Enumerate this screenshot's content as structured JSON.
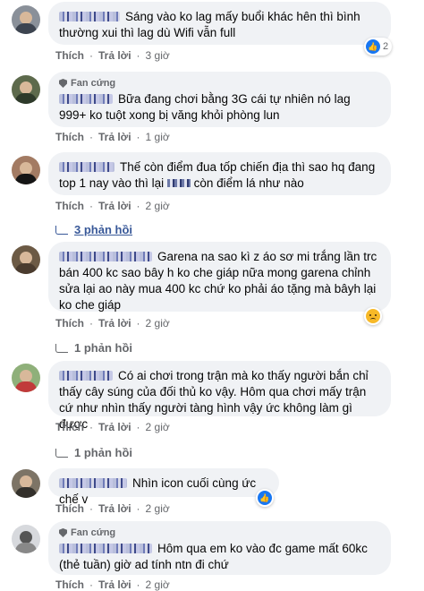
{
  "labels": {
    "like": "Thích",
    "reply": "Trả lời",
    "fan_badge": "Fan cứng"
  },
  "comments": [
    {
      "text": "Sáng vào ko lag mấy buổi khác hên thì bình thường xui thì lag dù Wifi vẫn full",
      "time": "3 giờ",
      "reaction": {
        "icon": "like-icon",
        "count": "2"
      }
    },
    {
      "text": "Bữa đang chơi bằng 3G cái tự nhiên nó lag 999+ ko tuột xong bị văng khỏi phòng lun",
      "time": "1 giờ",
      "fan": true
    },
    {
      "text_a": "Thế còn điểm đua tốp chiến địa thì sao hq đang top 1 nay vào thì lại",
      "text_b": "còn điểm lá như nào",
      "time": "2 giờ",
      "replies": "3 phản hồi"
    },
    {
      "text": "Garena na sao kì z áo sơ mi trắng lần trc bán 400 kc sao bây h ko che giáp nữa mong garena chỉnh sửa lại ao này mua 400 kc chứ ko phải áo tặng mà bâyh lại ko che giáp",
      "time": "2 giờ",
      "reaction": {
        "icon": "sad-icon"
      },
      "replies": "1 phản hồi"
    },
    {
      "text": "Có ai chơi trong trận mà ko thấy người bắn chỉ thấy cây súng của đối thủ ko vậy. Hôm qua chơi mấy trận cứ như nhìn thấy người tàng hình vậy ức không làm gì được",
      "time": "2 giờ",
      "replies": "1 phản hồi"
    },
    {
      "text": "Nhìn icon cuối cùng ức chế v",
      "time": "2 giờ",
      "reaction": {
        "icon": "like-icon"
      }
    },
    {
      "text": "Hôm qua em ko vào đc game mất 60kc (thẻ tuần) giờ ad tính ntn đi chứ",
      "time": "2 giờ",
      "fan": true
    }
  ]
}
